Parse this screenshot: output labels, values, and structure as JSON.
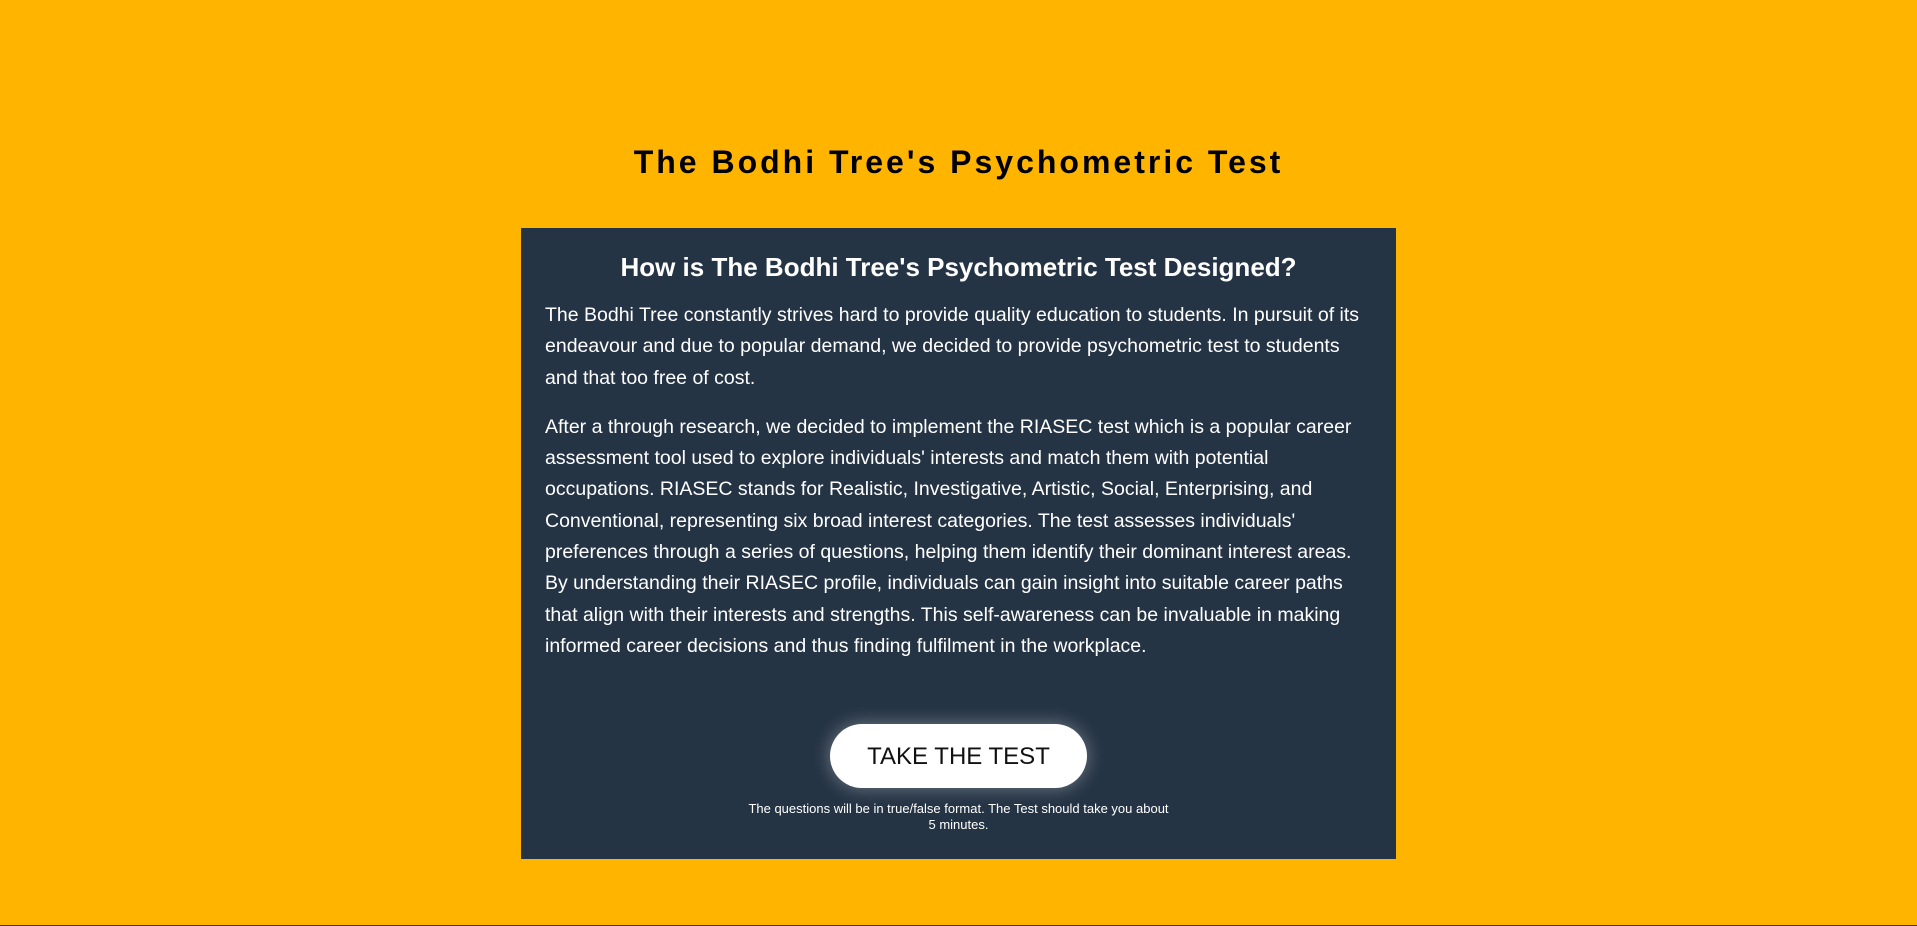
{
  "page": {
    "title": "The Bodhi Tree's Psychometric Test"
  },
  "card": {
    "heading": "How is The Bodhi Tree's Psychometric Test Designed?",
    "paragraphs": [
      "The Bodhi Tree constantly strives hard to provide quality education to students. In pursuit of its endeavour and due to popular demand, we decided to provide psychometric test to students and that too free of cost.",
      "After a through research, we decided to implement the RIASEC test which is a popular career assessment tool used to explore individuals' interests and match them with potential occupations. RIASEC stands for Realistic, Investigative, Artistic, Social, Enterprising, and Conventional, representing six broad interest categories. The test assesses individuals' preferences through a series of questions, helping them identify their dominant interest areas. By understanding their RIASEC profile, individuals can gain insight into suitable career paths that align with their interests and strengths. This self-awareness can be invaluable in making informed career decisions and thus finding fulfilment in the workplace."
    ],
    "cta_label": "TAKE THE TEST",
    "cta_note": "The questions will be in true/false format. The Test should take you about 5 minutes."
  },
  "colors": {
    "background": "#FFB400",
    "card": "#253445",
    "text_on_card": "#FFFFFF",
    "button": "#FFFFFF"
  }
}
